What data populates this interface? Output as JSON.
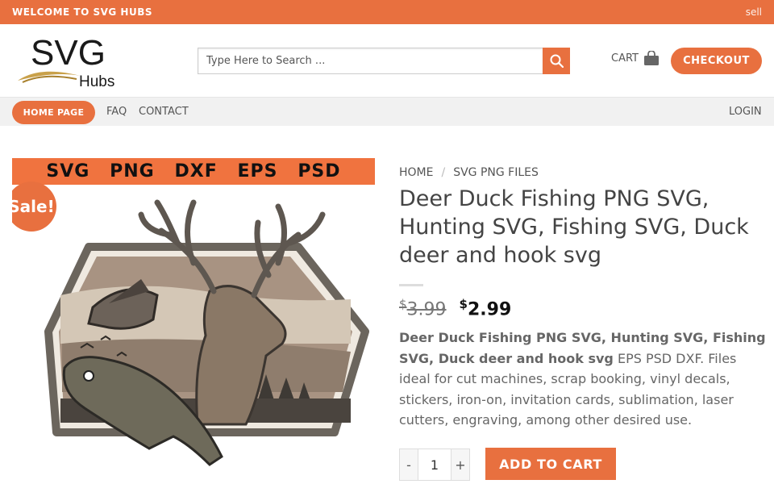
{
  "topbar": {
    "welcome": "WELCOME TO SVG HUBS",
    "sell": "sell"
  },
  "logo": {
    "main": "SVG",
    "sub": "Hubs"
  },
  "search": {
    "placeholder": "Type Here to Search ..."
  },
  "cart": {
    "label": "CART"
  },
  "checkout": {
    "label": "CHECKOUT"
  },
  "nav": {
    "home": "HOME PAGE",
    "faq": "FAQ",
    "contact": "CONTACT",
    "login": "LOGIN"
  },
  "product_image": {
    "formats": [
      "SVG",
      "PNG",
      "DXF",
      "EPS",
      "PSD"
    ],
    "sale_badge": "Sale!"
  },
  "breadcrumb": {
    "home": "HOME",
    "separator": "/",
    "category": "SVG PNG FILES"
  },
  "product": {
    "title": "Deer Duck Fishing PNG SVG, Hunting SVG, Fishing SVG, Duck deer and hook svg",
    "currency": "$",
    "old_price": "3.99",
    "new_price": "2.99",
    "desc_bold": "Deer Duck Fishing PNG SVG, Hunting SVG, Fishing SVG, Duck deer and hook svg",
    "desc_rest": " EPS PSD DXF. Files ideal for cut machines, scrap booking, vinyl decals, stickers, iron-on, invitation cards, sublimation, laser cutters, engraving, among other desired use."
  },
  "quantity": {
    "minus": "-",
    "value": "1",
    "plus": "+"
  },
  "add_to_cart": {
    "label": "ADD TO CART"
  },
  "colors": {
    "accent": "#e8703f",
    "nav_bg": "#f1f1f1"
  }
}
